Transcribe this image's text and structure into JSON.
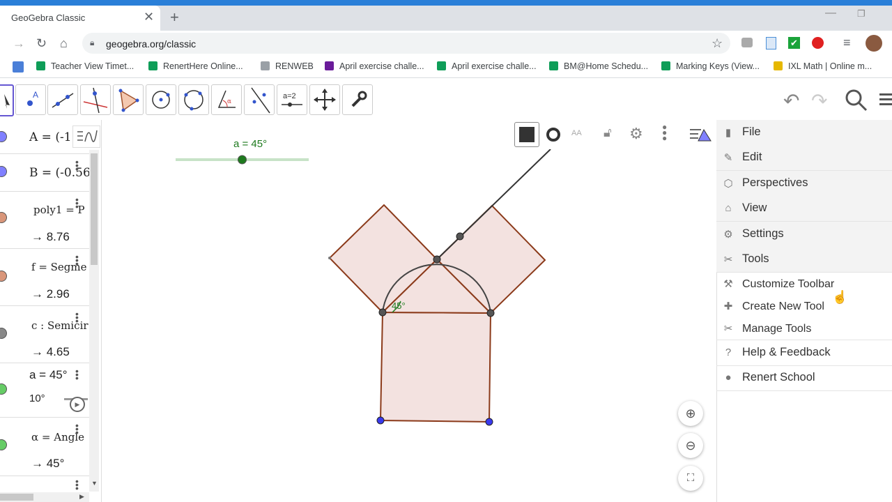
{
  "browser": {
    "tab_title": "GeoGebra Classic",
    "tab_close": "✕",
    "new_tab": "+",
    "url": "geogebra.org/classic",
    "bookmarks": [
      {
        "label": "Teacher View Timet...",
        "color": "#0f9d58"
      },
      {
        "label": "RenertHere Online...",
        "color": "#0f9d58"
      },
      {
        "label": "RENWEB",
        "color": "#9aa0a6"
      },
      {
        "label": "April exercise challe...",
        "color": "#6a1b9a"
      },
      {
        "label": "April exercise challe...",
        "color": "#0f9d58"
      },
      {
        "label": "BM@Home Schedu...",
        "color": "#0f9d58"
      },
      {
        "label": "Marking Keys (View...",
        "color": "#0f9d58"
      },
      {
        "label": "IXL Math | Online m...",
        "color": "#e6b800"
      }
    ]
  },
  "toolbar": {
    "tools": [
      "move-tool",
      "point-tool",
      "line-tool",
      "perpendicular-line-tool",
      "polygon-tool",
      "circle-center-tool",
      "circle-three-points-tool",
      "angle-tool",
      "reflect-tool",
      "slider-tool",
      "move-graphics-tool",
      "customize-tool"
    ],
    "slider_tool_text": "a=2"
  },
  "algebra": {
    "rows": [
      {
        "def": "A = (-1",
        "value": "",
        "marble": "#8080ff"
      },
      {
        "def": "B = (-0.56",
        "value": "",
        "marble": "#8080ff"
      },
      {
        "def": "poly1 = P",
        "value": "→  8.76",
        "marble": "#d9967a"
      },
      {
        "def": "f = Segme",
        "value": "→  2.96",
        "marble": "#d9967a"
      },
      {
        "def": "c : Semicir",
        "value": "→  4.65",
        "marble": "#888888"
      },
      {
        "def": "a = 45°",
        "value": "10°",
        "marble": "#66cc66"
      },
      {
        "def": "α = Angle",
        "value": "→  45°",
        "marble": "#66cc66"
      }
    ]
  },
  "graphics": {
    "slider_label": "a = 45°",
    "angle_label": "45°",
    "slider_value": 45,
    "slider_min": 10,
    "slider_max": 180
  },
  "menu": {
    "items": [
      {
        "label": "File",
        "icon": "file-icon"
      },
      {
        "label": "Edit",
        "icon": "pencil-icon"
      },
      {
        "label": "Perspectives",
        "icon": "perspectives-icon"
      },
      {
        "label": "View",
        "icon": "home-icon"
      },
      {
        "label": "Settings",
        "icon": "gear-icon"
      },
      {
        "label": "Tools",
        "icon": "tools-icon"
      }
    ],
    "sub_items": [
      {
        "label": "Customize Toolbar",
        "icon": "customize-icon"
      },
      {
        "label": "Create New Tool",
        "icon": "create-tool-icon"
      },
      {
        "label": "Manage Tools",
        "icon": "manage-tools-icon"
      }
    ],
    "help": "Help & Feedback",
    "user": "Renert School"
  },
  "colors": {
    "accent": "#2a7fd8",
    "polygon_fill": "#f3e2e0",
    "polygon_stroke": "#8b3a1a",
    "slider_green": "#1e7a1e"
  }
}
